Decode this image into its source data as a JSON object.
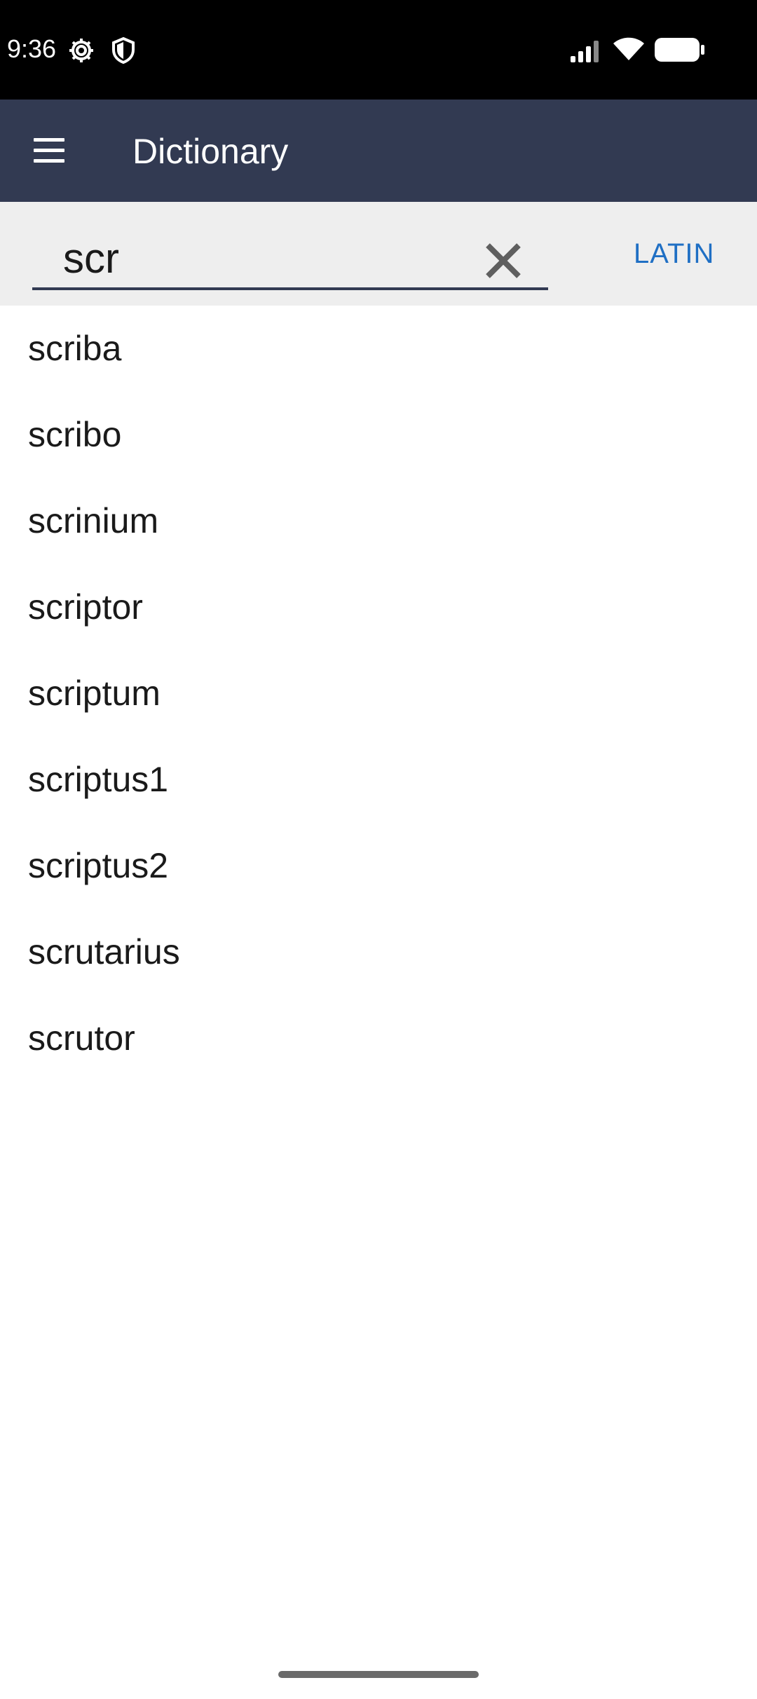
{
  "status_bar": {
    "time": "9:36",
    "icons": [
      "gear-icon",
      "shield-icon",
      "signal-icon",
      "wifi-icon",
      "battery-icon"
    ]
  },
  "app_bar": {
    "title": "Dictionary",
    "menu_icon": "hamburger-menu-icon",
    "background_color": "#323a52"
  },
  "search": {
    "value": "scr",
    "clear_icon": "close-icon",
    "language_button": "LATIN",
    "accent_color": "#1f6fc4"
  },
  "results": [
    {
      "word": "scriba"
    },
    {
      "word": "scribo"
    },
    {
      "word": "scrinium"
    },
    {
      "word": "scriptor"
    },
    {
      "word": "scriptum"
    },
    {
      "word": "scriptus1"
    },
    {
      "word": "scriptus2"
    },
    {
      "word": "scrutarius"
    },
    {
      "word": "scrutor"
    }
  ]
}
